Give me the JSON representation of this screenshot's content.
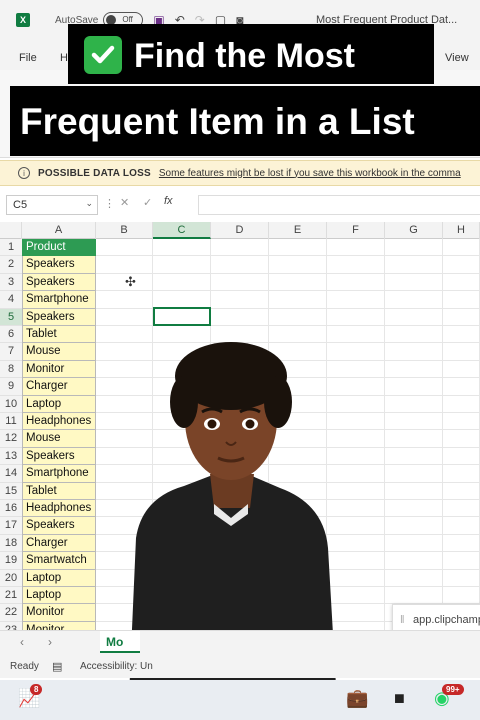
{
  "window": {
    "autosave_label": "AutoSave",
    "autosave_state": "Off",
    "doc_title": "Most Frequent Product Dat..."
  },
  "menu": {
    "file": "File",
    "home": "H",
    "view": "View"
  },
  "overlay": {
    "line1": "Find the Most",
    "line2": "Frequent Item in a List"
  },
  "infobar": {
    "title": "POSSIBLE DATA LOSS",
    "message": "Some features might be lost if you save this workbook in the comma"
  },
  "formula_bar": {
    "name_box": "C5",
    "fx": "fx",
    "value": ""
  },
  "columns": [
    "A",
    "B",
    "C",
    "D",
    "E",
    "F",
    "G",
    "H"
  ],
  "active_column": "C",
  "active_row": 5,
  "rows": [
    "1",
    "2",
    "3",
    "4",
    "5",
    "6",
    "7",
    "8",
    "9",
    "10",
    "11",
    "12",
    "13",
    "14",
    "15",
    "16",
    "17",
    "18",
    "19",
    "20",
    "21",
    "22",
    "23"
  ],
  "column_a": [
    "Product",
    "Speakers",
    "Speakers",
    "Smartphone",
    "Speakers",
    "Tablet",
    "Mouse",
    "Monitor",
    "Charger",
    "Laptop",
    "Headphones",
    "Mouse",
    "Speakers",
    "Smartphone",
    "Tablet",
    "Headphones",
    "Speakers",
    "Charger",
    "Smartwatch",
    "Laptop",
    "Laptop",
    "Monitor",
    "Monitor"
  ],
  "popup": {
    "text": "app.clipchamp"
  },
  "sheet_tab": "Mo",
  "status": {
    "ready": "Ready",
    "accessibility": "Accessibility: Un"
  },
  "taskbar": {
    "badge1": "8",
    "badge2": "99+"
  },
  "colors": {
    "accent": "#107c41",
    "header_fill": "#2d9b53",
    "data_fill": "#fff9c4",
    "overlay_bg": "#000000",
    "check_green": "#2fb34a"
  }
}
